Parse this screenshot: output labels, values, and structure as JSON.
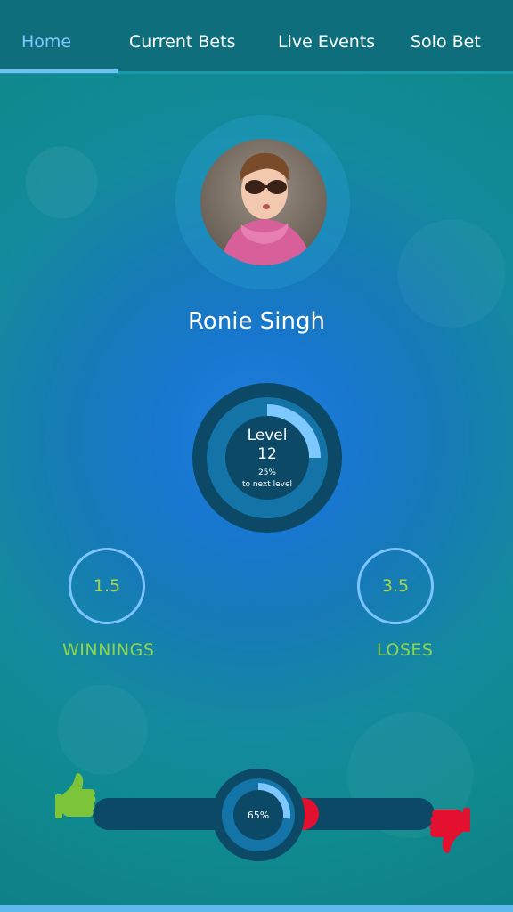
{
  "nav": {
    "tabs": [
      {
        "label": "Home",
        "active": true
      },
      {
        "label": "Current Bets",
        "active": false
      },
      {
        "label": "Live Events",
        "active": false
      },
      {
        "label": "Solo Bet",
        "active": false
      }
    ]
  },
  "profile": {
    "name": "Ronie Singh",
    "avatar_icon": "user-photo"
  },
  "level": {
    "label": "Level",
    "value": "12",
    "progress_text": "25%",
    "progress_caption": "to next level",
    "progress_fraction": 0.25
  },
  "stats": {
    "winnings_value": "1.5",
    "winnings_label": "WINNINGS",
    "loses_value": "3.5",
    "loses_label": "LOSES"
  },
  "vote": {
    "percent_text": "65%",
    "fraction": 0.65,
    "up_icon": "thumbs-up-icon",
    "down_icon": "thumbs-down-icon"
  },
  "colors": {
    "accent": "#6ec0f5",
    "stat_text": "#8fd44a",
    "ring_dark": "#0b4966",
    "ring_mid": "#1474a8",
    "ring_fill": "#7cc8ff",
    "up_green": "#7cc43a",
    "down_red": "#e3102f"
  }
}
